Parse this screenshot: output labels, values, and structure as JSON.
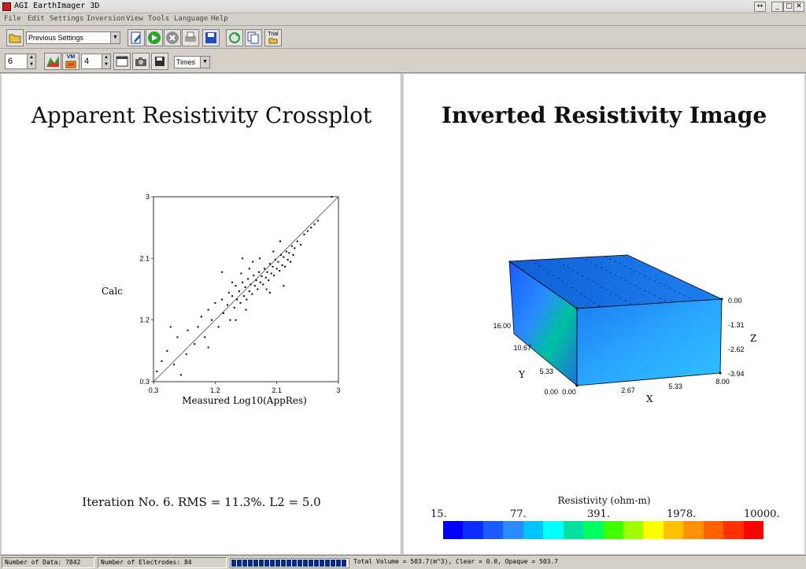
{
  "window": {
    "title": "AGI EarthImager 3D"
  },
  "menu": [
    "File",
    "Edit",
    "Settings",
    "Inversion",
    "View",
    "Tools",
    "Language",
    "Help"
  ],
  "toolbar": {
    "settings_combo": "Previous Settings",
    "trial_label": "Trial",
    "iteration_spinner": "6",
    "vm_label": "VM",
    "count_spinner": "4",
    "font_combo": "Times"
  },
  "left_panel": {
    "title": "Apparent Resistivity Crossplot",
    "summary": "Iteration No. 6.  RMS = 11.3%.  L2 = 5.0"
  },
  "right_panel": {
    "title": "Inverted Resistivity Image",
    "axis_x_label": "X",
    "axis_y_label": "Y",
    "axis_z_label": "Z",
    "x_ticks": [
      "0.00",
      "2.67",
      "5.33",
      "8.00"
    ],
    "y_ticks": [
      "0.00",
      "5.33",
      "10.67",
      "16.00"
    ],
    "z_ticks": [
      "0.00",
      "-1.31",
      "-2.62",
      "-3.94"
    ],
    "colorbar_title": "Resistivity (ohm-m)",
    "colorbar_labels": [
      "15.",
      "77.",
      "391.",
      "1978.",
      "10000."
    ],
    "colorbar_colors": [
      "#0000ff",
      "#0a2cff",
      "#1a5cff",
      "#2a8cff",
      "#00c4ff",
      "#00ffff",
      "#00e0a0",
      "#00ff60",
      "#40ff00",
      "#a0ff00",
      "#ffff00",
      "#ffc000",
      "#ff9000",
      "#ff6000",
      "#ff3000",
      "#ff0000"
    ]
  },
  "chart_data": {
    "type": "scatter",
    "title": "",
    "xlabel": "Measured Log10(AppRes)",
    "ylabel": "Calc",
    "xlim": [
      0.3,
      3
    ],
    "ylim": [
      0.3,
      3
    ],
    "x_ticks": [
      "0.3",
      "1.2",
      "2.1",
      "3"
    ],
    "y_ticks": [
      "0.3",
      "1.2",
      "2.1",
      "3"
    ],
    "reference_line": {
      "from": [
        0.3,
        0.3
      ],
      "to": [
        3,
        3
      ],
      "color": "#4040c0"
    },
    "points": [
      [
        0.35,
        0.45
      ],
      [
        0.42,
        0.6
      ],
      [
        0.5,
        0.75
      ],
      [
        0.6,
        0.55
      ],
      [
        0.65,
        0.95
      ],
      [
        0.78,
        0.7
      ],
      [
        0.8,
        1.05
      ],
      [
        0.9,
        0.85
      ],
      [
        0.95,
        1.1
      ],
      [
        1.0,
        1.25
      ],
      [
        1.05,
        0.95
      ],
      [
        1.1,
        1.35
      ],
      [
        1.15,
        1.2
      ],
      [
        1.2,
        1.45
      ],
      [
        1.25,
        1.1
      ],
      [
        1.3,
        1.5
      ],
      [
        1.32,
        1.3
      ],
      [
        1.38,
        1.42
      ],
      [
        1.4,
        1.6
      ],
      [
        1.42,
        1.2
      ],
      [
        1.45,
        1.55
      ],
      [
        1.48,
        1.38
      ],
      [
        1.5,
        1.7
      ],
      [
        1.52,
        1.5
      ],
      [
        1.55,
        1.62
      ],
      [
        1.57,
        1.45
      ],
      [
        1.6,
        1.75
      ],
      [
        1.62,
        1.55
      ],
      [
        1.64,
        1.68
      ],
      [
        1.66,
        1.5
      ],
      [
        1.68,
        1.8
      ],
      [
        1.7,
        1.62
      ],
      [
        1.72,
        1.72
      ],
      [
        1.74,
        1.58
      ],
      [
        1.76,
        1.85
      ],
      [
        1.78,
        1.7
      ],
      [
        1.8,
        1.78
      ],
      [
        1.82,
        1.65
      ],
      [
        1.84,
        1.9
      ],
      [
        1.86,
        1.75
      ],
      [
        1.88,
        1.84
      ],
      [
        1.9,
        1.72
      ],
      [
        1.92,
        1.95
      ],
      [
        1.94,
        1.82
      ],
      [
        1.96,
        1.9
      ],
      [
        1.98,
        1.78
      ],
      [
        2.0,
        2.02
      ],
      [
        2.02,
        1.88
      ],
      [
        2.04,
        1.98
      ],
      [
        2.06,
        1.85
      ],
      [
        2.08,
        2.08
      ],
      [
        2.1,
        1.95
      ],
      [
        2.12,
        2.05
      ],
      [
        2.14,
        1.92
      ],
      [
        2.16,
        2.15
      ],
      [
        2.18,
        2.0
      ],
      [
        2.2,
        2.12
      ],
      [
        2.22,
        1.98
      ],
      [
        2.24,
        2.2
      ],
      [
        2.26,
        2.08
      ],
      [
        2.28,
        2.18
      ],
      [
        2.3,
        2.05
      ],
      [
        2.32,
        2.28
      ],
      [
        2.34,
        2.15
      ],
      [
        2.36,
        2.25
      ],
      [
        2.4,
        2.35
      ],
      [
        2.45,
        2.3
      ],
      [
        2.5,
        2.45
      ],
      [
        2.55,
        2.5
      ],
      [
        2.6,
        2.55
      ],
      [
        2.65,
        2.6
      ],
      [
        2.7,
        2.65
      ],
      [
        2.9,
        3.0
      ],
      [
        1.6,
        2.1
      ],
      [
        2.2,
        1.7
      ],
      [
        1.3,
        1.9
      ],
      [
        0.55,
        1.1
      ],
      [
        0.7,
        0.4
      ],
      [
        1.1,
        0.8
      ],
      [
        1.75,
        2.05
      ],
      [
        2.0,
        1.6
      ],
      [
        1.5,
        1.2
      ],
      [
        1.85,
        2.1
      ],
      [
        2.15,
        2.35
      ],
      [
        1.95,
        1.65
      ],
      [
        1.7,
        1.95
      ],
      [
        1.65,
        1.35
      ],
      [
        2.05,
        2.2
      ],
      [
        1.45,
        1.75
      ],
      [
        1.58,
        1.88
      ]
    ]
  },
  "status": {
    "data": "Number of Data: 7842",
    "electrodes": "Number of Electrodes: 84",
    "volume": "Total Volume = 503.7(m^3),   Clear = 0.0,   Opaque = 503.7"
  }
}
